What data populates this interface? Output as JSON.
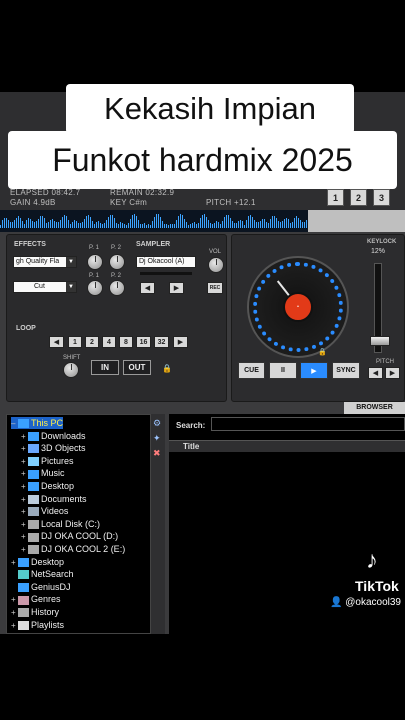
{
  "overlay": {
    "line1": "Kekasih Impian",
    "line2": "Funkot hardmix 2025"
  },
  "deck": {
    "elapsed": "ELAPSED 08:42.7",
    "remain": "REMAIN 02:32.9",
    "gain": "GAIN 4.9dB",
    "key": "KEY C#m",
    "pitch": "PITCH +12.1",
    "deck_buttons": [
      "1",
      "2",
      "3"
    ],
    "keylock_label": "KEYLOCK",
    "pitch_percent": "12%",
    "pitch_label": "PITCH"
  },
  "effects": {
    "label": "EFFECTS",
    "effect1": "gh Quality Fla",
    "effect2": "Cut",
    "p1": "P. 1",
    "p2": "P. 2"
  },
  "sampler": {
    "label": "SAMPLER",
    "value": "Dj Okacool (A)",
    "vol_label": "VOL",
    "rec_label": "REC"
  },
  "loop": {
    "label": "LOOP",
    "sizes": [
      "1",
      "2",
      "4",
      "8",
      "16",
      "32"
    ],
    "shift_label": "SHIFT",
    "in_label": "IN",
    "out_label": "OUT"
  },
  "transport": {
    "cue": "CUE",
    "pause": "II",
    "play": "▶",
    "sync": "SYNC"
  },
  "browser": {
    "tab_label": "BROWSER",
    "search_label": "Search:",
    "search_value": "",
    "column_title": "Title",
    "tree": [
      {
        "label": "This PC",
        "pm": "–",
        "indent": 0,
        "selected": true,
        "icon": "computer-icon"
      },
      {
        "label": "Downloads",
        "pm": "+",
        "indent": 1,
        "icon": "download-icon"
      },
      {
        "label": "3D Objects",
        "pm": "+",
        "indent": 1,
        "icon": "cube-icon"
      },
      {
        "label": "Pictures",
        "pm": "+",
        "indent": 1,
        "icon": "pictures-icon"
      },
      {
        "label": "Music",
        "pm": "+",
        "indent": 1,
        "icon": "music-icon"
      },
      {
        "label": "Desktop",
        "pm": "+",
        "indent": 1,
        "icon": "desktop-icon"
      },
      {
        "label": "Documents",
        "pm": "+",
        "indent": 1,
        "icon": "documents-icon"
      },
      {
        "label": "Videos",
        "pm": "+",
        "indent": 1,
        "icon": "videos-icon"
      },
      {
        "label": "Local Disk (C:)",
        "pm": "+",
        "indent": 1,
        "icon": "drive-icon"
      },
      {
        "label": "DJ OKA COOL (D:)",
        "pm": "+",
        "indent": 1,
        "icon": "drive-icon"
      },
      {
        "label": "DJ OKA COOL 2 (E:)",
        "pm": "+",
        "indent": 1,
        "icon": "drive-icon"
      },
      {
        "label": "Desktop",
        "pm": "+",
        "indent": 0,
        "icon": "desktop-icon"
      },
      {
        "label": "NetSearch",
        "pm": "",
        "indent": 0,
        "icon": "globe-icon"
      },
      {
        "label": "GeniusDJ",
        "pm": "",
        "indent": 0,
        "icon": "genius-icon"
      },
      {
        "label": "Genres",
        "pm": "+",
        "indent": 0,
        "icon": "genres-icon"
      },
      {
        "label": "History",
        "pm": "+",
        "indent": 0,
        "icon": "history-icon"
      },
      {
        "label": "Playlists",
        "pm": "+",
        "indent": 0,
        "icon": "playlist-icon"
      }
    ]
  },
  "watermark": {
    "brand": "TikTok",
    "user": "@okacool39"
  },
  "colors": {
    "accent_blue": "#2a8cff",
    "jog_center": "#e23a18",
    "selected_row": "#1d63c9",
    "selected_text": "#ffef4a"
  }
}
